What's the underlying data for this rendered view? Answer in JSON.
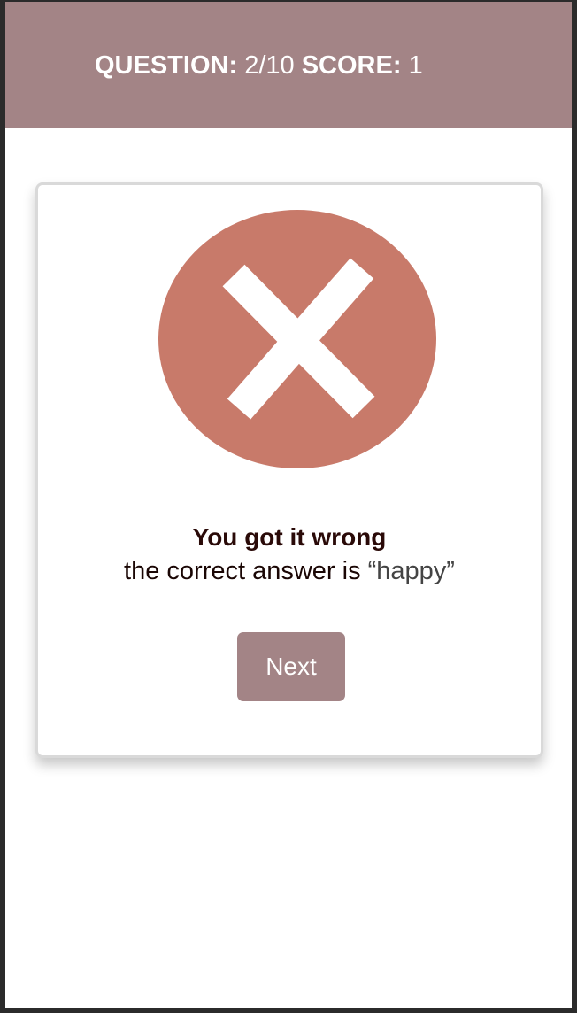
{
  "header": {
    "question_label": "QUESTION:",
    "question_value": "2/10",
    "score_label": "SCORE:",
    "score_value": "1"
  },
  "result": {
    "icon": "cross-icon",
    "title": "You got it wrong",
    "answer_prefix": "the correct answer is",
    "answer_word": "“happy”",
    "next_label": "Next"
  },
  "colors": {
    "header_bg": "#a38486",
    "icon_circle": "#c87a6a",
    "button_bg": "#a38486"
  }
}
